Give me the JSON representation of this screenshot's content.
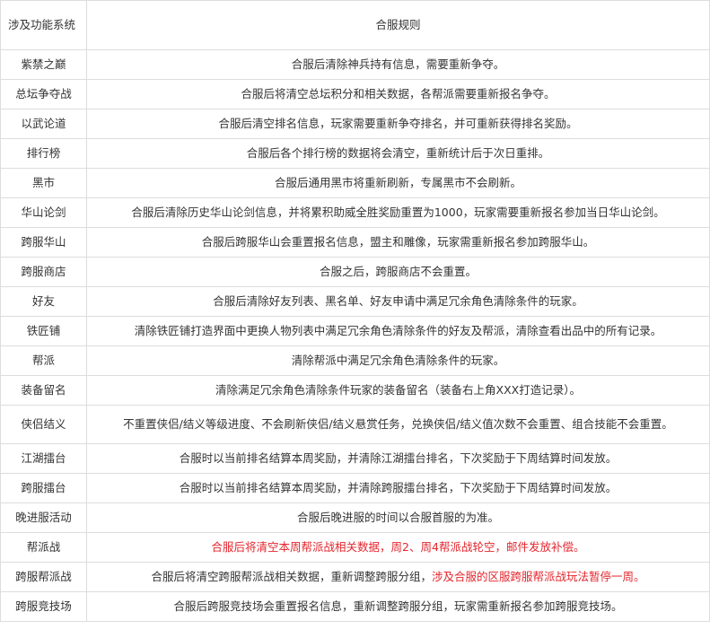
{
  "table": {
    "headers": [
      "涉及功能系统",
      "合服规则"
    ],
    "rows": [
      {
        "system": "紫禁之巅",
        "rule": [
          {
            "text": "合服后清除神兵持有信息，需要重新争夺。"
          }
        ]
      },
      {
        "system": "总坛争夺战",
        "rule": [
          {
            "text": "合服后将清空总坛积分和相关数据，各帮派需要重新报名争夺。"
          }
        ]
      },
      {
        "system": "以武论道",
        "rule": [
          {
            "text": "合服后清空排名信息，玩家需要重新争夺排名，并可重新获得排名奖励。"
          }
        ]
      },
      {
        "system": "排行榜",
        "rule": [
          {
            "text": "合服后各个排行榜的数据将会清空，重新统计后于次日重排。"
          }
        ]
      },
      {
        "system": "黑市",
        "rule": [
          {
            "text": "合服后通用黑市将重新刷新，专属黑市不会刷新。"
          }
        ]
      },
      {
        "system": "华山论剑",
        "rule": [
          {
            "text": "合服后清除历史华山论剑信息，并将累积助威全胜奖励重置为1000，玩家需要重新报名参加当日华山论剑。"
          }
        ]
      },
      {
        "system": "跨服华山",
        "rule": [
          {
            "text": "合服后跨服华山会重置报名信息，盟主和雕像，玩家需重新报名参加跨服华山。"
          }
        ]
      },
      {
        "system": "跨服商店",
        "rule": [
          {
            "text": "合服之后，跨服商店不会重置。"
          }
        ]
      },
      {
        "system": "好友",
        "rule": [
          {
            "text": "合服后清除好友列表、黑名单、好友申请中满足冗余角色清除条件的玩家。"
          }
        ]
      },
      {
        "system": "铁匠铺",
        "rule": [
          {
            "text": "清除铁匠铺打造界面中更换人物列表中满足冗余角色清除条件的好友及帮派，清除查看出品中的所有记录。"
          }
        ]
      },
      {
        "system": "帮派",
        "rule": [
          {
            "text": "清除帮派中满足冗余角色清除条件的玩家。"
          }
        ]
      },
      {
        "system": "装备留名",
        "rule": [
          {
            "text": "清除满足冗余角色清除条件玩家的装备留名（装备右上角XXX打造记录）。"
          }
        ]
      },
      {
        "system": "侠侣结义",
        "tall": true,
        "rule": [
          {
            "text": "不重置侠侣/结义等级进度、不会刷新侠侣/结义悬赏任务，兑换侠侣/结义值次数不会重置、组合技能不会重置。"
          }
        ]
      },
      {
        "system": "江湖擂台",
        "rule": [
          {
            "text": "合服时以当前排名结算本周奖励，并清除江湖擂台排名，下次奖励于下周结算时间发放。"
          }
        ]
      },
      {
        "system": "跨服擂台",
        "rule": [
          {
            "text": "合服时以当前排名结算本周奖励，并清除跨服擂台排名，下次奖励于下周结算时间发放。"
          }
        ]
      },
      {
        "system": "晚进服活动",
        "rule": [
          {
            "text": "合服后晚进服的时间以合服首服的为准。"
          }
        ]
      },
      {
        "system": "帮派战",
        "rule": [
          {
            "text": "合服后将清空本周帮派战相关数据，周2、周4帮派战轮空，邮件发放补偿。",
            "highlight": true
          }
        ]
      },
      {
        "system": "跨服帮派战",
        "rule": [
          {
            "text": "合服后将清空跨服帮派战相关数据，重新调整跨服分组，"
          },
          {
            "text": "涉及合服的区服跨服帮派战玩法暂停一周。",
            "highlight": true
          }
        ]
      },
      {
        "system": "跨服竞技场",
        "rule": [
          {
            "text": "合服后跨服竞技场会重置报名信息，重新调整跨服分组，玩家需重新报名参加跨服竞技场。"
          }
        ]
      }
    ],
    "highlight_color": "#e4262d"
  }
}
